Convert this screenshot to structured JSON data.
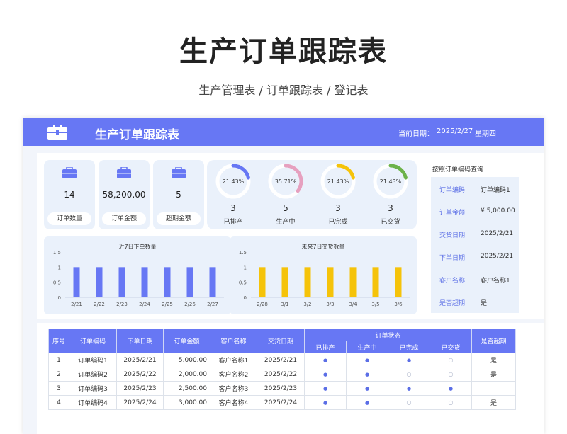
{
  "page": {
    "title": "生产订单跟踪表",
    "subtitle": "生产管理表 / 订单跟踪表 / 登记表"
  },
  "header": {
    "title": "生产订单跟踪表",
    "date_label": "当前日期：",
    "date_value": "2025/2/27",
    "weekday": "星期四"
  },
  "kpis": [
    {
      "icon": "briefcase-icon",
      "value": "14",
      "label": "订单数量"
    },
    {
      "icon": "briefcase-icon",
      "value": "58,200.00",
      "label": "订单金额"
    },
    {
      "icon": "briefcase-icon",
      "value": "5",
      "label": "超期金额"
    }
  ],
  "status_rings": [
    {
      "pct": "21.43%",
      "fraction": 0.2143,
      "count": "3",
      "label": "已排产",
      "color": "#6777f4"
    },
    {
      "pct": "35.71%",
      "fraction": 0.3571,
      "count": "5",
      "label": "生产中",
      "color": "#e6a0bf"
    },
    {
      "pct": "21.43%",
      "fraction": 0.2143,
      "count": "3",
      "label": "已完成",
      "color": "#f5c30a"
    },
    {
      "pct": "21.43%",
      "fraction": 0.2143,
      "count": "3",
      "label": "已交货",
      "color": "#6cb24a"
    }
  ],
  "query": {
    "title": "按照订单编码查询",
    "fields": [
      {
        "key": "订单编码",
        "value": "订单编码1"
      },
      {
        "key": "订单金额",
        "value": "¥ 5,000.00"
      },
      {
        "key": "交货日期",
        "value": "2025/2/21"
      },
      {
        "key": "下单日期",
        "value": "2025/2/21"
      },
      {
        "key": "客户名称",
        "value": "客户名称1"
      },
      {
        "key": "是否超期",
        "value": "是"
      }
    ]
  },
  "chart_data": [
    {
      "type": "bar",
      "title": "近7日下单数量",
      "categories": [
        "2/21",
        "2/22",
        "2/23",
        "2/24",
        "2/25",
        "2/26",
        "2/27"
      ],
      "values": [
        1,
        1,
        1,
        1,
        1,
        1,
        1
      ],
      "ylim": [
        0,
        1.5
      ],
      "yticks": [
        "0",
        "0.5",
        "1",
        "1.5"
      ],
      "color": "#6777f4"
    },
    {
      "type": "bar",
      "title": "未来7日交货数量",
      "categories": [
        "2/28",
        "3/1",
        "3/2",
        "3/3",
        "3/4",
        "3/5",
        "3/6"
      ],
      "values": [
        1,
        1,
        1,
        1,
        1,
        1,
        1
      ],
      "ylim": [
        0,
        1.5
      ],
      "yticks": [
        "0",
        "0.5",
        "1",
        "1.5"
      ],
      "color": "#f5c30a"
    }
  ],
  "table": {
    "headers": [
      "序号",
      "订单编码",
      "下单日期",
      "订单金额",
      "客户名称",
      "交货日期",
      "订单状态",
      "是否超期"
    ],
    "status_headers": [
      "已排产",
      "生产中",
      "已完成",
      "已交货"
    ],
    "filled_dot": "●",
    "empty_dot": "○",
    "rows": [
      {
        "idx": "1",
        "code": "订单编码1",
        "order_date": "2025/2/21",
        "amount": "5,000.00",
        "customer": "客户名称1",
        "delivery": "2025/2/21",
        "status": [
          true,
          true,
          true,
          false
        ],
        "overdue": "是"
      },
      {
        "idx": "2",
        "code": "订单编码2",
        "order_date": "2025/2/22",
        "amount": "2,000.00",
        "customer": "客户名称2",
        "delivery": "2025/2/22",
        "status": [
          true,
          true,
          false,
          false
        ],
        "overdue": "是"
      },
      {
        "idx": "3",
        "code": "订单编码3",
        "order_date": "2025/2/23",
        "amount": "2,500.00",
        "customer": "客户名称3",
        "delivery": "2025/2/23",
        "status": [
          true,
          true,
          true,
          true
        ],
        "overdue": ""
      },
      {
        "idx": "4",
        "code": "订单编码4",
        "order_date": "2025/2/24",
        "amount": "3,000.00",
        "customer": "客户名称4",
        "delivery": "2025/2/24",
        "status": [
          true,
          true,
          false,
          false
        ],
        "overdue": "是"
      }
    ]
  }
}
